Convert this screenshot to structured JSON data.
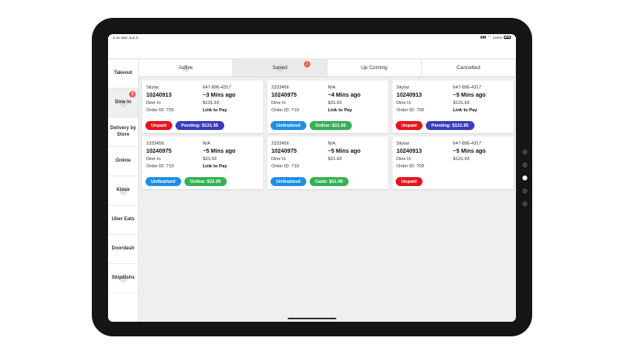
{
  "status_bar": {
    "time": "6:41",
    "date": "Mon Jun 6",
    "battery": "100%"
  },
  "sidebar": {
    "items": [
      {
        "label": "Takeout",
        "badge": ""
      },
      {
        "label": "Dine In",
        "badge": "2",
        "active": true
      },
      {
        "label": "Delivery by Store",
        "badge": ""
      },
      {
        "label": "Online",
        "badge": ""
      },
      {
        "label": "Kiosk",
        "badge": ""
      },
      {
        "label": "Uber Eats",
        "badge": ""
      },
      {
        "label": "Doordash",
        "badge": ""
      },
      {
        "label": "Skipdishs",
        "badge": ""
      }
    ]
  },
  "tabs": [
    {
      "label": "Active",
      "badge": ""
    },
    {
      "label": "Saved",
      "badge": "2",
      "active": true
    },
    {
      "label": "Up Coming",
      "badge": ""
    },
    {
      "label": "Cancelled",
      "badge": ""
    }
  ],
  "orders": [
    {
      "name": "Skylar",
      "phone": "647-896-4317",
      "number": "10240913",
      "time": "~3 Mins ago",
      "type": "Dine In",
      "amount": "$131.93",
      "order_id": "Order ID: 709",
      "pay_link": "Link to Pay",
      "pills": [
        {
          "kind": "unpaid",
          "label": "Unpaid"
        },
        {
          "kind": "pending",
          "label": "Pending: $131.95"
        }
      ]
    },
    {
      "name": "2333456",
      "phone": "N/A",
      "number": "10240975",
      "time": "~4 Mins ago",
      "type": "Dine In",
      "amount": "$31.93",
      "order_id": "Order ID: 719",
      "pay_link": "Link to Pay",
      "pills": [
        {
          "kind": "unfinal",
          "label": "Unfinalized"
        },
        {
          "kind": "green",
          "label": "Online: $31.95"
        }
      ]
    },
    {
      "name": "Skylar",
      "phone": "647-896-4317",
      "number": "10240913",
      "time": "~5 Mins ago",
      "type": "Dine In",
      "amount": "$131.93",
      "order_id": "Order ID: 709",
      "pay_link": "Link to Pay",
      "pills": [
        {
          "kind": "unpaid",
          "label": "Unpaid"
        },
        {
          "kind": "pending",
          "label": "Pending: $131.95"
        }
      ]
    },
    {
      "name": "2333456",
      "phone": "N/A",
      "number": "10240975",
      "time": "~5 Mins ago",
      "type": "Dine In",
      "amount": "$31.93",
      "order_id": "Order ID: 719",
      "pay_link": "Link to Pay",
      "pills": [
        {
          "kind": "unfinal",
          "label": "Unfinalized"
        },
        {
          "kind": "green",
          "label": "Online: $31.95"
        }
      ]
    },
    {
      "name": "2333456",
      "phone": "N/A",
      "number": "10240975",
      "time": "~5 Mins ago",
      "type": "Dine In",
      "amount": "$31.93",
      "order_id": "Order ID: 719",
      "pay_link": "",
      "pills": [
        {
          "kind": "unfinal",
          "label": "Unfinalized"
        },
        {
          "kind": "green",
          "label": "Cash: $31.95"
        }
      ]
    },
    {
      "name": "Skylar",
      "phone": "647-896-4317",
      "number": "10240913",
      "time": "~5 Mins ago",
      "type": "Dine In",
      "amount": "$131.93",
      "order_id": "Order ID: 709",
      "pay_link": "",
      "pills": [
        {
          "kind": "unpaid",
          "label": "Unpaid"
        }
      ]
    }
  ],
  "colors": {
    "unpaid": "#e8141c",
    "pending": "#3b3db8",
    "unfinalized": "#1e8fe6",
    "paid": "#36b155",
    "badge": "#f05a5a"
  }
}
